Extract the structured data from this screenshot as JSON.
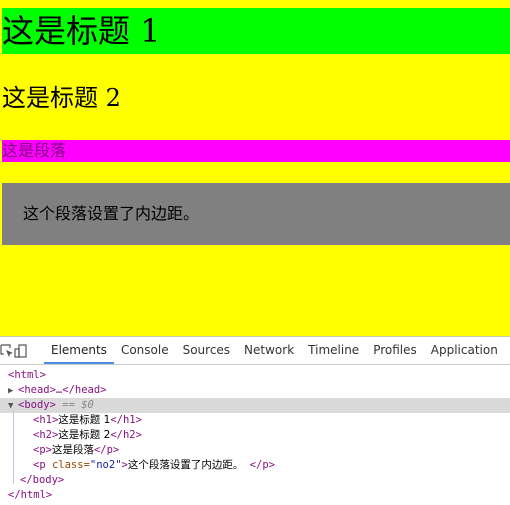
{
  "page": {
    "h1": "这是标题 1",
    "h2": "这是标题 2",
    "p": "这是段落",
    "p_padded": "这个段落设置了内边距。",
    "colors": {
      "background": "#ffff00",
      "h1_bg": "#00ff00",
      "p_bg": "#ff00ff",
      "p_text": "#800080",
      "p_padded_bg": "#808080"
    }
  },
  "devtools": {
    "toolbar_icons": [
      "inspect-element-icon",
      "device-mode-icon"
    ],
    "tabs": [
      "Elements",
      "Console",
      "Sources",
      "Network",
      "Timeline",
      "Profiles",
      "Application",
      "S"
    ],
    "active_tab": "Elements",
    "tree": {
      "html_open": "<html>",
      "head": "<head>…</head>",
      "body_open": "<body>",
      "body_marker": "== $0",
      "h1_open": "<h1>",
      "h1_text": "这是标题 1",
      "h1_close": "</h1>",
      "h2_open": "<h2>",
      "h2_text": "这是标题 2",
      "h2_close": "</h2>",
      "p_open": "<p>",
      "p_text": "这是段落",
      "p_close": "</p>",
      "p2_open_start": "<p ",
      "p2_attr": "class=",
      "p2_val": "\"no2\"",
      "p2_open_end": ">",
      "p2_text": "这个段落设置了内边距。",
      "p2_close": "</p>",
      "body_close": "</body>",
      "html_close": "</html>"
    }
  }
}
